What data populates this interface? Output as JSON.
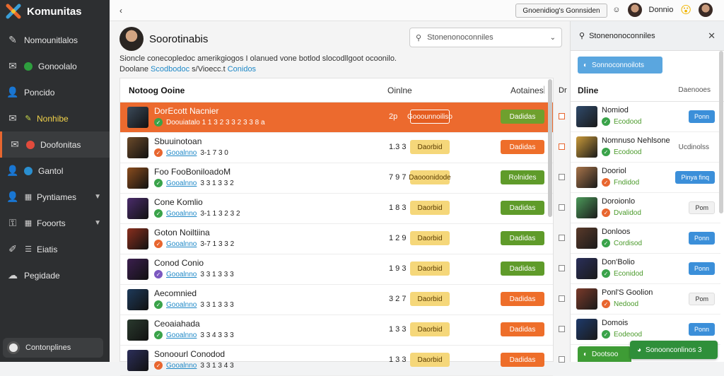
{
  "app": {
    "brand": "Komunitas"
  },
  "sidebar": {
    "items": [
      {
        "label": "Nomounitlalos",
        "icon": "pencil-icon"
      },
      {
        "label": "Gonoolalo",
        "icon": "mail-icon",
        "dot": "#2e9e3e"
      },
      {
        "label": "Poncido",
        "icon": "person-icon"
      },
      {
        "label": "Nonhibe",
        "icon": "mail-icon",
        "dot_text": "pencil"
      },
      {
        "label": "Doofonitas",
        "icon": "mail-icon",
        "dot": "#e24b3c",
        "active": true
      },
      {
        "label": "Gantol",
        "icon": "person-icon",
        "dot": "#2a8fd0"
      },
      {
        "label": "Pyntiames",
        "icon": "person-icon",
        "chevron": true
      },
      {
        "label": "Fooorts",
        "icon": "key-icon",
        "chevron": true
      },
      {
        "label": "Eiatis",
        "icon": "brush-icon"
      },
      {
        "label": "Pegidade",
        "icon": "cloud-icon"
      }
    ],
    "user_label": "Contonplines"
  },
  "topbar": {
    "back": "‹",
    "center_button": "Gnoenidiog's Gonnsiden",
    "user_name": "Donnio"
  },
  "main": {
    "title": "Soorotinabis",
    "search_placeholder": "Stonenonoconniles",
    "desc_line1": "Sioncle conecopledoc amerikgiogos I olanued  vone botlod slocodllgoot ocoonilo.",
    "desc_line2_prefix": "Doolane ",
    "desc_link1": "Scodbodoc",
    "desc_mid": " s/Vioecc.t ",
    "desc_link2": "Conidos"
  },
  "table": {
    "headers": {
      "name": "Notoog Ooine",
      "online": "Oinlne",
      "actions": "Aotaines",
      "extra": "Dr"
    },
    "rows": [
      {
        "name": "DorEcott Nacnier",
        "meta": "Doouiatalo 1 1 3 2 3 3 2 3 3 8 a",
        "num": "2p",
        "tag": "Gooounnoiliso",
        "action": "Dadidas",
        "hl": true,
        "check_color": "#3aa34a",
        "thumb": "#3b4a5a",
        "tag_bg": "#e55d20",
        "action_bg": "#6fa02e"
      },
      {
        "name": "Sbuuinotoan",
        "meta_link": "Gooalnno",
        "meta": "3-1 7 3 0",
        "num": "1.3 3",
        "tag": "Daorbid",
        "action": "Dadidas",
        "check_color": "#e8662f",
        "thumb": "#6b4a2a",
        "tag_bg": "#f5d77a",
        "action_bg": "#ee6e2a"
      },
      {
        "name": "Foo FooBoniloadoM",
        "meta_link": "Gooalnno",
        "meta": "3 3 1 3 3 2",
        "num": "7 9 7",
        "tag": "Daooonidode",
        "action": "Rolnides",
        "check_color": "#3aa34a",
        "thumb": "#8a4d1e",
        "tag_bg": "#f5d77a",
        "action_bg": "#5f9b2a"
      },
      {
        "name": "Cone Komlio",
        "meta_link": "Gooalnno",
        "meta": "3-1 1 3 2 3 2",
        "num": "1 8 3",
        "tag": "Daorbid",
        "action": "Dadidas",
        "check_color": "#3aa34a",
        "thumb": "#4a2c6b",
        "tag_bg": "#f5d77a",
        "action_bg": "#5f9b2a"
      },
      {
        "name": "Goton Noiltiina",
        "meta_link": "Gooalnno",
        "meta": "3-7 1 3 3 2",
        "num": "1 2 9",
        "tag": "Daorbid",
        "action": "Dadidas",
        "check_color": "#e8662f",
        "thumb": "#8a2f1e",
        "tag_bg": "#f5d77a",
        "action_bg": "#5f9b2a"
      },
      {
        "name": "Conod Conio",
        "meta_link": "Gooalnno",
        "meta": "3 3 1 3 3 3",
        "num": "1 9 3",
        "tag": "Daorbid",
        "action": "Dadidas",
        "check_color": "#7b58c0",
        "thumb": "#3b1f4e",
        "tag_bg": "#f5d77a",
        "action_bg": "#5f9b2a"
      },
      {
        "name": "Aecomnied",
        "meta_link": "Gooalnno",
        "meta": "3 3 1 3 3 3",
        "num": "3 2 7",
        "tag": "Daorbid",
        "action": "Dadidas",
        "check_color": "#3aa34a",
        "thumb": "#1e3a5a",
        "tag_bg": "#f5d77a",
        "action_bg": "#ee6e2a"
      },
      {
        "name": "Ceoaiahada",
        "meta_link": "Gooalnno",
        "meta": "3 3 4 3 3 3",
        "num": "1 3 3",
        "tag": "Daorbid",
        "action": "Dadidas",
        "check_color": "#3aa34a",
        "thumb": "#2a3a2e",
        "tag_bg": "#f5d77a",
        "action_bg": "#ee6e2a"
      },
      {
        "name": "Sonoourl Conodod",
        "meta_link": "Gooalnno",
        "meta": "3 3 1 3 4 3",
        "num": "1 3 3",
        "tag": "Daorbid",
        "action": "Dadidas",
        "check_color": "#e8662f",
        "thumb": "#2c2f5a",
        "tag_bg": "#f5d77a",
        "action_bg": "#ee6e2a"
      }
    ]
  },
  "right_panel": {
    "top_label": "Stonenonoconniles",
    "top_button": "Sonnoconnoilots",
    "header": "Dline",
    "header_sub": "Daenooes",
    "items": [
      {
        "name": "Nomiod",
        "status": "Ecodood",
        "btn": "Ponn",
        "btn_style": "blue",
        "thumb": "#2f4a6b"
      },
      {
        "name": "Nomnuso Nehlsone",
        "status": "Ecodood",
        "btn": "Ucdinolss",
        "btn_style": "none",
        "thumb": "#c99a3a"
      },
      {
        "name": "Dooriol",
        "status": "Fndidod",
        "btn": "Pinya finq",
        "btn_style": "blue",
        "thumb": "#a8744a"
      },
      {
        "name": "Doroionlo",
        "status": "Dvalidod",
        "btn": "Pom",
        "btn_style": "grey",
        "thumb": "#4c9a5a"
      },
      {
        "name": "Donloos",
        "status": "Cordisod",
        "btn": "Ponn",
        "btn_style": "blue",
        "thumb": "#5a3a2a"
      },
      {
        "name": "Don'Bolio",
        "status": "Econidod",
        "btn": "Ponn",
        "btn_style": "blue",
        "thumb": "#2a2f5a"
      },
      {
        "name": "Ponl'S Goolion",
        "status": "Nedood",
        "btn": "Pom",
        "btn_style": "grey",
        "thumb": "#7a3a2a"
      },
      {
        "name": "Domois",
        "status": "Eodeood",
        "btn": "Ponn",
        "btn_style": "blue",
        "thumb": "#1e3a6b"
      }
    ]
  },
  "toasts": {
    "left": "Dootsoo",
    "right": "Sonoonconlinos 3"
  },
  "colors": {
    "accent": "#ec6a2e",
    "sidebar_bg": "#2d2f31",
    "link": "#1e88c7",
    "blue_btn": "#3b8fd9"
  }
}
